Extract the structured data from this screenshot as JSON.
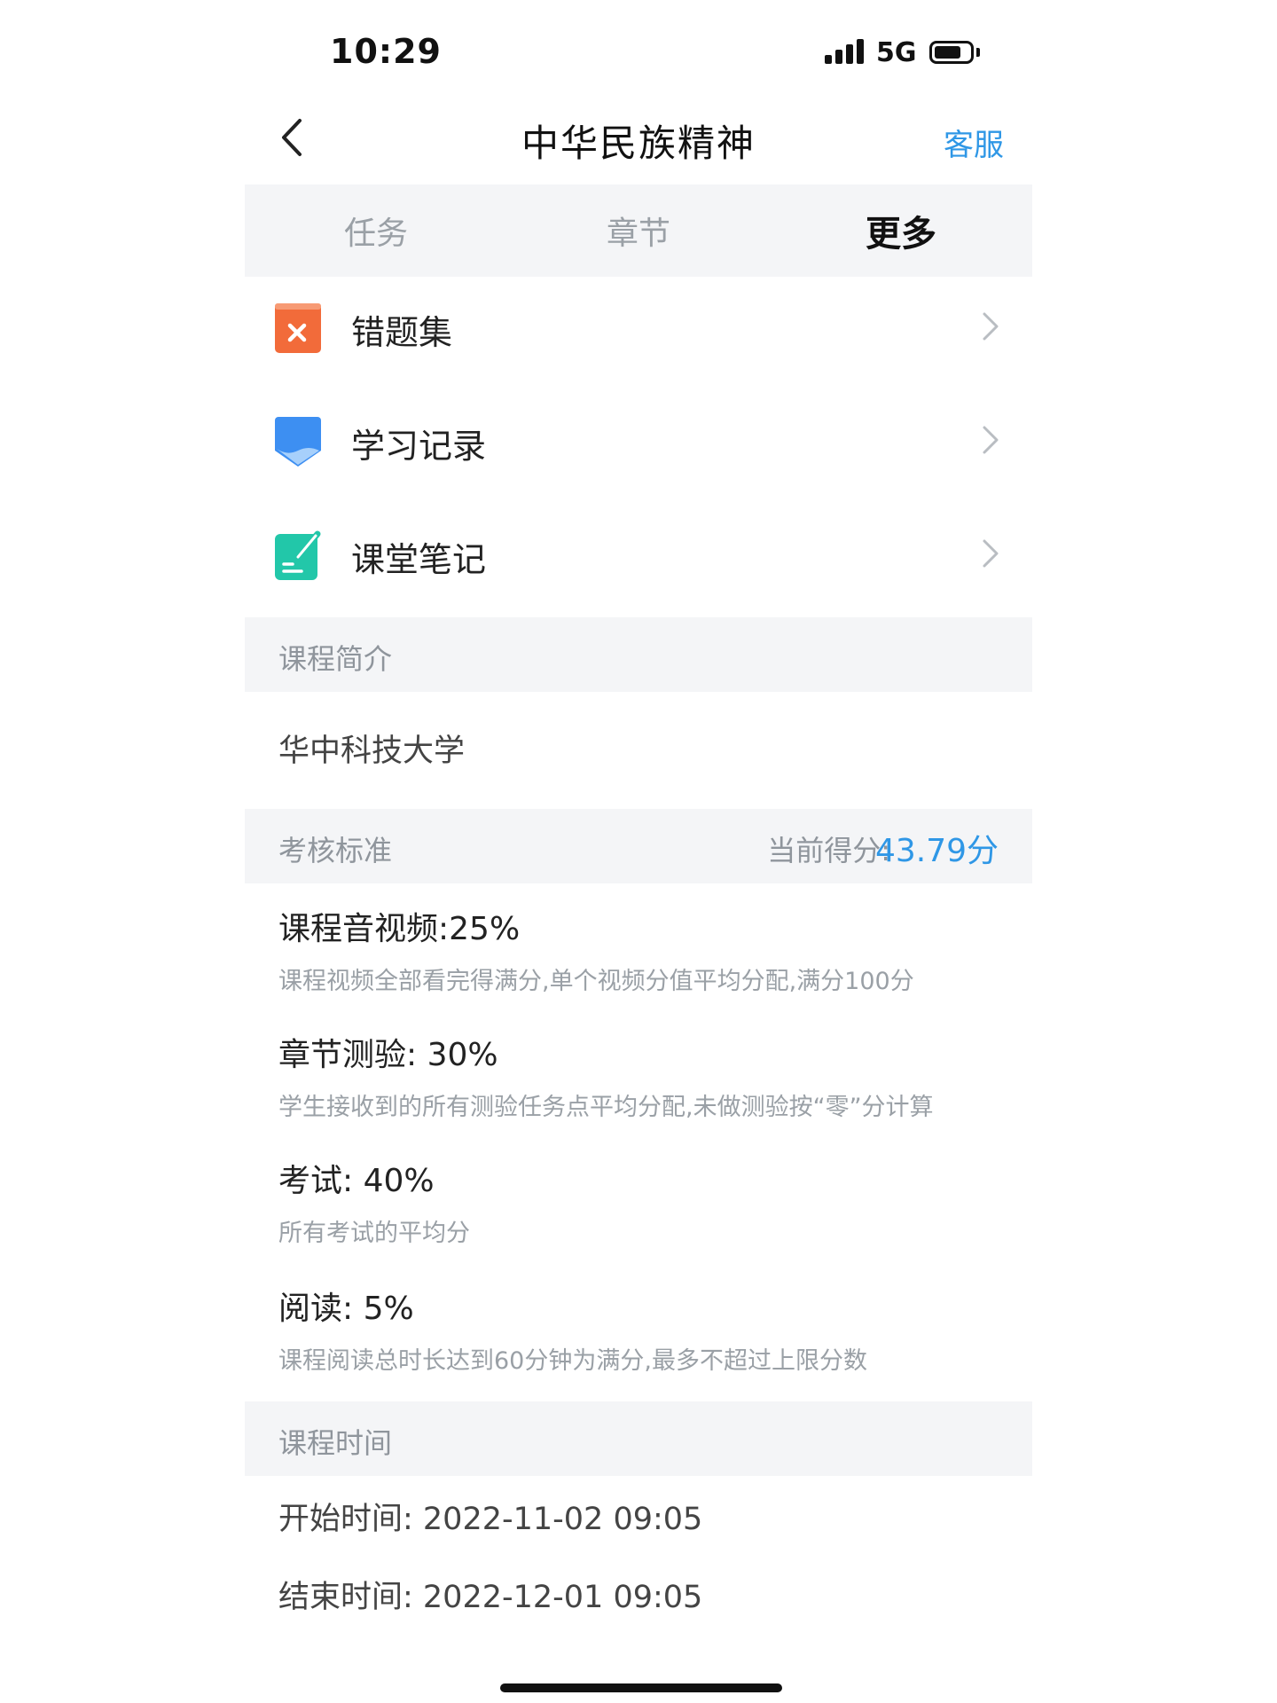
{
  "status_bar": {
    "time": "10:29",
    "network": "5G",
    "battery_level": 0.75
  },
  "header": {
    "title": "中华民族精神",
    "service_label": "客服"
  },
  "tabs": [
    {
      "label": "任务",
      "active": false
    },
    {
      "label": "章节",
      "active": false
    },
    {
      "label": "更多",
      "active": true
    }
  ],
  "menu": [
    {
      "label": "错题集",
      "icon": "wrong-questions-book-icon",
      "color": "#f26b3a"
    },
    {
      "label": "学习记录",
      "icon": "study-record-bookmark-icon",
      "color": "#3d8ff2"
    },
    {
      "label": "课堂笔记",
      "icon": "class-notes-icon",
      "color": "#22c7a9"
    }
  ],
  "intro": {
    "heading": "课程简介",
    "text": "华中科技大学"
  },
  "assessment": {
    "heading": "考核标准",
    "score_label": "当前得分:",
    "score_value": "43.79分",
    "criteria": [
      {
        "title": "课程音视频:25%",
        "desc": "课程视频全部看完得满分,单个视频分值平均分配,满分100分"
      },
      {
        "title": "章节测验: 30%",
        "desc": "学生接收到的所有测验任务点平均分配,未做测验按“零”分计算"
      },
      {
        "title": "考试: 40%",
        "desc": "所有考试的平均分"
      },
      {
        "title": "阅读: 5%",
        "desc": "课程阅读总时长达到60分钟为满分,最多不超过上限分数"
      }
    ]
  },
  "schedule": {
    "heading": "课程时间",
    "start": "开始时间: 2022-11-02 09:05",
    "end": "结束时间: 2022-12-01 09:05"
  },
  "colors": {
    "accent": "#2f97e6",
    "section_bg": "#f4f5f7"
  }
}
